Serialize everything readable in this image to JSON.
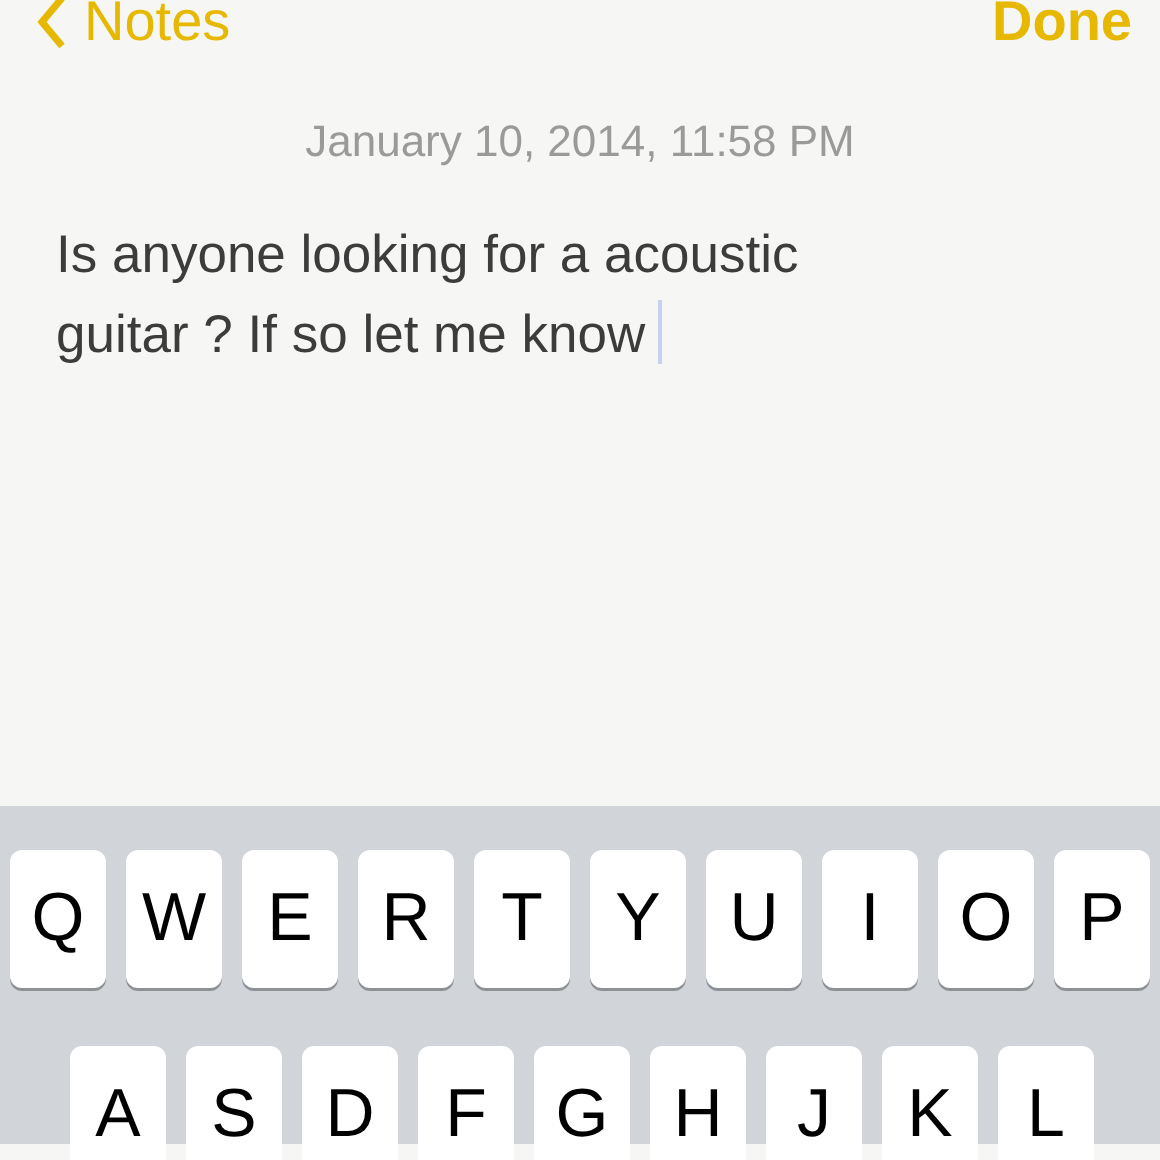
{
  "nav": {
    "back_label": "Notes",
    "done_label": "Done"
  },
  "note": {
    "date": "January 10, 2014, 11:58 PM",
    "text": "Is anyone looking for a acoustic guitar ? If so let me know",
    "cursor_visible": true
  },
  "keyboard": {
    "rows": [
      [
        "Q",
        "W",
        "E",
        "R",
        "T",
        "Y",
        "U",
        "I",
        "O",
        "P"
      ],
      [
        "A",
        "S",
        "D",
        "F",
        "G",
        "H",
        "J",
        "K",
        "L"
      ]
    ]
  }
}
